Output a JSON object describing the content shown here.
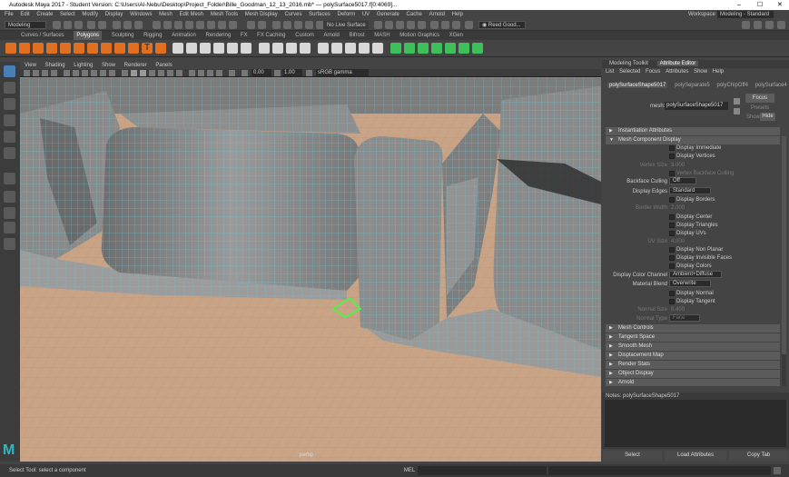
{
  "window": {
    "title": "Autodesk Maya 2017 - Student Version: C:\\Users\\Al-Nebu\\Desktop\\Project_Folder\\Bille_Goodman_12_13_2016.mb* --- polySurface5017.f[0:4069]...",
    "controls": [
      "–",
      "☐",
      "✕"
    ]
  },
  "menubar": [
    "File",
    "Edit",
    "Create",
    "Select",
    "Modify",
    "Display",
    "Windows",
    "Mesh",
    "Edit Mesh",
    "Mesh Tools",
    "Mesh Display",
    "Curves",
    "Surfaces",
    "Deform",
    "UV",
    "Generate",
    "Cache",
    "Arnold",
    "Help"
  ],
  "workspace": {
    "label": "Workspace :",
    "value": "Modeling - Standard"
  },
  "status_line": {
    "mode": "Modeling",
    "live_surface": "No Live Surface",
    "user": "Reed Good..."
  },
  "shelf_tabs": [
    {
      "label": "Curves / Surfaces",
      "active": false
    },
    {
      "label": "Polygons",
      "active": true
    },
    {
      "label": "Sculpting",
      "active": false
    },
    {
      "label": "Rigging",
      "active": false
    },
    {
      "label": "Animation",
      "active": false
    },
    {
      "label": "Rendering",
      "active": false
    },
    {
      "label": "FX",
      "active": false
    },
    {
      "label": "FX Caching",
      "active": false
    },
    {
      "label": "Custom",
      "active": false
    },
    {
      "label": "Arnold",
      "active": false
    },
    {
      "label": "Bifrost",
      "active": false
    },
    {
      "label": "MASH",
      "active": false
    },
    {
      "label": "Motion Graphics",
      "active": false
    },
    {
      "label": "XGen",
      "active": false
    }
  ],
  "viewport": {
    "menu": [
      "View",
      "Shading",
      "Lighting",
      "Show",
      "Renderer",
      "Panels"
    ],
    "field1": "0.00",
    "field2": "1.00",
    "colorspace": "sRGB gamma",
    "camera_label": "persp"
  },
  "right_panel": {
    "tabs": [
      {
        "label": "Modeling Toolkit",
        "active": false
      },
      {
        "label": "Attribute Editor",
        "active": true
      }
    ],
    "menu": [
      "List",
      "Selected",
      "Focus",
      "Attributes",
      "Show",
      "Help"
    ],
    "node_tabs": [
      {
        "label": "polySurfaceShape5017",
        "active": true
      },
      {
        "label": "polySeparate5",
        "active": false
      },
      {
        "label": "polyChipOff4",
        "active": false
      },
      {
        "label": "polySurface4",
        "active": false
      }
    ],
    "mesh_label": "mesh:",
    "mesh_name": "polySurfaceShape5017",
    "focus_btn": "Focus",
    "presets_btn": "Presets",
    "show_label": "Show",
    "hide_btn": "Hide",
    "sections_top": [
      {
        "label": "Instantiation Attributes",
        "open": false
      },
      {
        "label": "Mesh Component Display",
        "open": true
      }
    ],
    "mcd": {
      "display_immediate": "Display Immediate",
      "display_vertices": "Display Vertices",
      "vertex_size_label": "Vertex Size",
      "vertex_size": "3.000",
      "vertex_backface": "Vertex Backface Culling",
      "backface_label": "Backface Culling",
      "backface_value": "Off",
      "display_edges_label": "Display Edges",
      "display_edges_value": "Standard",
      "display_borders": "Display Borders",
      "border_width_label": "Border Width",
      "border_width": "2.000",
      "display_center": "Display Center",
      "display_triangles": "Display Triangles",
      "display_uvs": "Display UVs",
      "uv_size_label": "UV Size",
      "uv_size": "4.000",
      "display_non_planar": "Display Non Planar",
      "display_invisible": "Display Invisible Faces",
      "display_colors": "Display Colors",
      "color_channel_label": "Display Color Channel",
      "color_channel_value": "Ambient+Diffuse",
      "material_blend_label": "Material Blend",
      "material_blend_value": "Overwrite",
      "display_normal": "Display Normal",
      "display_tangent": "Display Tangent",
      "normal_size_label": "Normal Size",
      "normal_size": "0.400",
      "normal_type_label": "Normal Type",
      "normal_type": "Face"
    },
    "sections_bottom": [
      "Mesh Controls",
      "Tangent Space",
      "Smooth Mesh",
      "Displacement Map",
      "Render Stats",
      "Object Display",
      "Arnold"
    ],
    "notes_label": "Notes: polySurfaceShape5017",
    "bottom_buttons": [
      "Select",
      "Load Attributes",
      "Copy Tab"
    ]
  },
  "help_line": {
    "text": "Select Tool: select a component",
    "mel_label": "MEL"
  },
  "colors": {
    "wire": "#5fd3e6",
    "selection": "#3cff3c",
    "floor": "#c9a385",
    "mesh": "#8a8a8a"
  }
}
